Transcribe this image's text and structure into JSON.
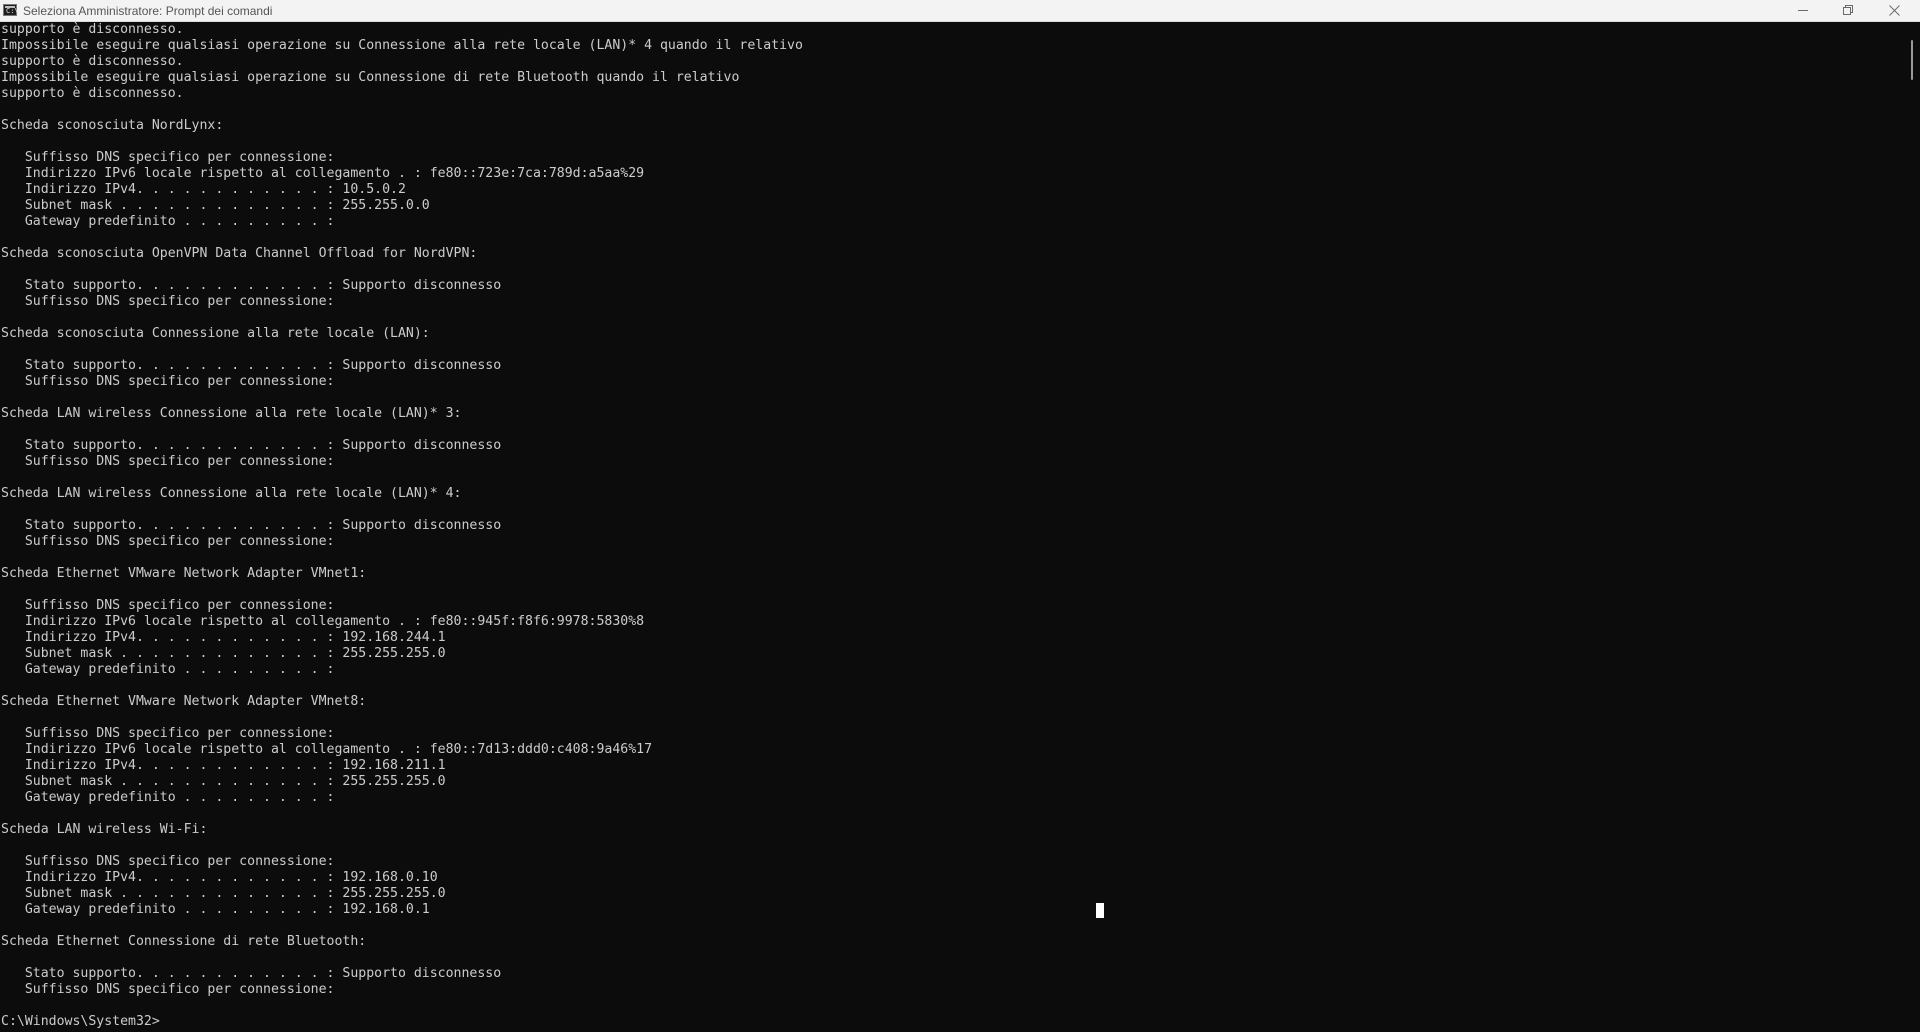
{
  "window": {
    "title": "Seleziona Amministratore: Prompt dei comandi",
    "icon": "cmd-icon",
    "icon_glyph": "C:\\",
    "controls": [
      "minimize-icon",
      "maximize-icon",
      "close-icon"
    ]
  },
  "console": {
    "lines": [
      "supporto è disconnesso.",
      "Impossibile eseguire qualsiasi operazione su Connessione alla rete locale (LAN)* 4 quando il relativo",
      "supporto è disconnesso.",
      "Impossibile eseguire qualsiasi operazione su Connessione di rete Bluetooth quando il relativo",
      "supporto è disconnesso.",
      "",
      "Scheda sconosciuta NordLynx:",
      "",
      "   Suffisso DNS specifico per connessione:",
      "   Indirizzo IPv6 locale rispetto al collegamento . : fe80::723e:7ca:789d:a5aa%29",
      "   Indirizzo IPv4. . . . . . . . . . . . : 10.5.0.2",
      "   Subnet mask . . . . . . . . . . . . . : 255.255.0.0",
      "   Gateway predefinito . . . . . . . . . :",
      "",
      "Scheda sconosciuta OpenVPN Data Channel Offload for NordVPN:",
      "",
      "   Stato supporto. . . . . . . . . . . . : Supporto disconnesso",
      "   Suffisso DNS specifico per connessione:",
      "",
      "Scheda sconosciuta Connessione alla rete locale (LAN):",
      "",
      "   Stato supporto. . . . . . . . . . . . : Supporto disconnesso",
      "   Suffisso DNS specifico per connessione:",
      "",
      "Scheda LAN wireless Connessione alla rete locale (LAN)* 3:",
      "",
      "   Stato supporto. . . . . . . . . . . . : Supporto disconnesso",
      "   Suffisso DNS specifico per connessione:",
      "",
      "Scheda LAN wireless Connessione alla rete locale (LAN)* 4:",
      "",
      "   Stato supporto. . . . . . . . . . . . : Supporto disconnesso",
      "   Suffisso DNS specifico per connessione:",
      "",
      "Scheda Ethernet VMware Network Adapter VMnet1:",
      "",
      "   Suffisso DNS specifico per connessione:",
      "   Indirizzo IPv6 locale rispetto al collegamento . : fe80::945f:f8f6:9978:5830%8",
      "   Indirizzo IPv4. . . . . . . . . . . . : 192.168.244.1",
      "   Subnet mask . . . . . . . . . . . . . : 255.255.255.0",
      "   Gateway predefinito . . . . . . . . . :",
      "",
      "Scheda Ethernet VMware Network Adapter VMnet8:",
      "",
      "   Suffisso DNS specifico per connessione:",
      "   Indirizzo IPv6 locale rispetto al collegamento . : fe80::7d13:ddd0:c408:9a46%17",
      "   Indirizzo IPv4. . . . . . . . . . . . : 192.168.211.1",
      "   Subnet mask . . . . . . . . . . . . . : 255.255.255.0",
      "   Gateway predefinito . . . . . . . . . :",
      "",
      "Scheda LAN wireless Wi-Fi:",
      "",
      "   Suffisso DNS specifico per connessione:",
      "   Indirizzo IPv4. . . . . . . . . . . . : 192.168.0.10",
      "   Subnet mask . . . . . . . . . . . . . : 255.255.255.0",
      "   Gateway predefinito . . . . . . . . . : 192.168.0.1",
      "",
      "Scheda Ethernet Connessione di rete Bluetooth:",
      "",
      "   Stato supporto. . . . . . . . . . . . : Supporto disconnesso",
      "   Suffisso DNS specifico per connessione:",
      "",
      "C:\\Windows\\System32>"
    ]
  },
  "colors": {
    "background": "#0c0c0c",
    "text": "#cccccc",
    "titlebar": "#f3f3f3",
    "cursor": "#ffffff"
  }
}
